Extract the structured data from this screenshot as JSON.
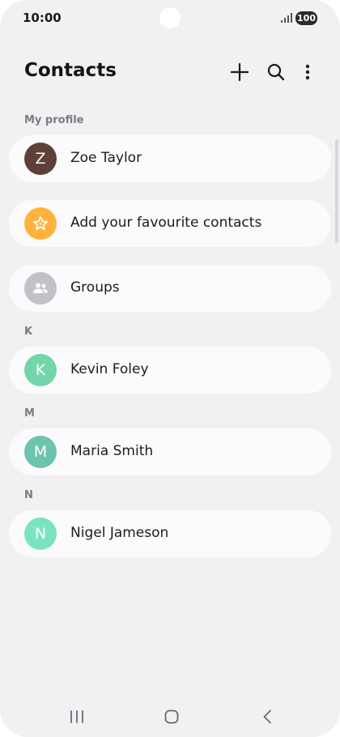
{
  "status": {
    "time": "10:00",
    "battery": "100"
  },
  "header": {
    "title": "Contacts"
  },
  "sections": {
    "my_profile": "My profile",
    "k": "K",
    "m": "M",
    "n": "N"
  },
  "profile": {
    "initial": "Z",
    "name": "Zoe Taylor",
    "color": "#5d4037"
  },
  "favourites": {
    "label": "Add your favourite contacts",
    "color": "#ffb23e"
  },
  "groups": {
    "label": "Groups",
    "color": "#c2c2c6"
  },
  "contacts": [
    {
      "initial": "K",
      "name": "Kevin Foley",
      "color": "#72d6a8"
    },
    {
      "initial": "M",
      "name": "Maria Smith",
      "color": "#6cc4ae"
    },
    {
      "initial": "N",
      "name": "Nigel Jameson",
      "color": "#7ce3c0"
    }
  ],
  "icons": {
    "add": "plus-icon",
    "search": "search-icon",
    "more": "more-vertical-icon",
    "favourites": "star-icon",
    "groups": "people-icon",
    "nav_recent": "recent-apps-icon",
    "nav_home": "home-icon",
    "nav_back": "back-icon"
  }
}
